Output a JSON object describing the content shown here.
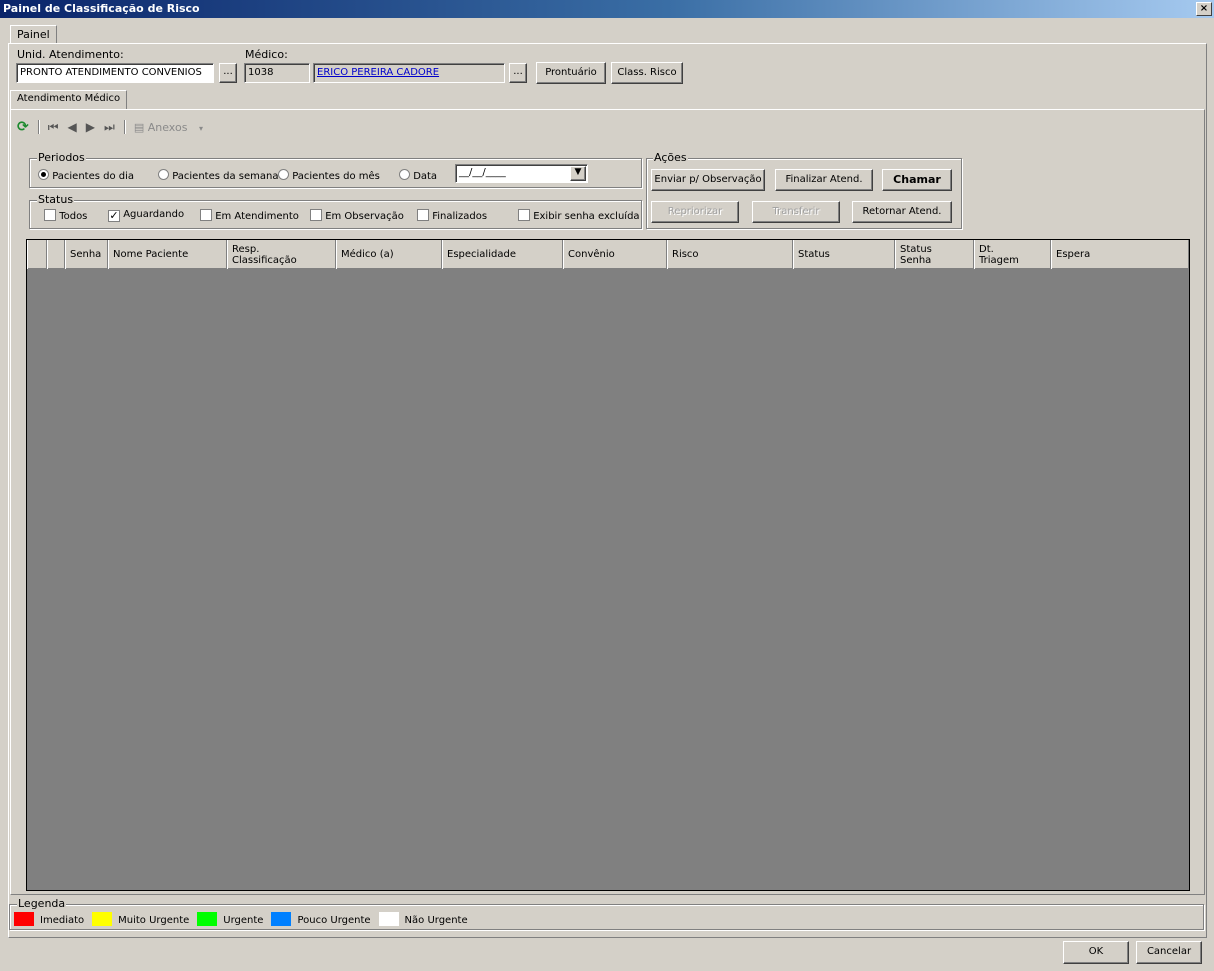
{
  "window": {
    "title": "Painel de Classificação de Risco",
    "close_label": "×"
  },
  "tabs": {
    "outer": "Painel",
    "inner": "Atendimento Médico"
  },
  "header": {
    "unid_label": "Unid. Atendimento:",
    "unid_value": "PRONTO ATENDIMENTO CONVENIOS",
    "medico_label": "Médico:",
    "medico_code": "1038",
    "medico_name": "ERICO PEREIRA CADORE",
    "dots_label": "...",
    "prontuario_label": "Prontuário",
    "class_risco_label": "Class. Risco"
  },
  "toolbar": {
    "anexos_label": "Anexos"
  },
  "periodos": {
    "title": "Periodos",
    "options": [
      "Pacientes do dia",
      "Pacientes da semana",
      "Pacientes do mês",
      "Data"
    ],
    "selected": 0,
    "date_value": "__/__/____"
  },
  "status": {
    "title": "Status",
    "options": [
      {
        "label": "Todos",
        "checked": false
      },
      {
        "label": "Aguardando",
        "checked": true
      },
      {
        "label": "Em Atendimento",
        "checked": false
      },
      {
        "label": "Em Observação",
        "checked": false
      },
      {
        "label": "Finalizados",
        "checked": false
      }
    ],
    "exibir_label": "Exibir senha excluída",
    "exibir_checked": false
  },
  "acoes": {
    "title": "Ações",
    "enviar": "Enviar p/ Observação",
    "finalizar": "Finalizar Atend.",
    "chamar": "Chamar",
    "repriorizar": "Repriorizar",
    "transferir": "Transferir",
    "retornar": "Retornar Atend."
  },
  "grid": {
    "columns": [
      {
        "l1": "",
        "l2": ""
      },
      {
        "l1": "",
        "l2": ""
      },
      {
        "l1": "Senha",
        "l2": ""
      },
      {
        "l1": "Nome Paciente",
        "l2": ""
      },
      {
        "l1": "Resp.",
        "l2": "Classificação"
      },
      {
        "l1": "Médico (a)",
        "l2": ""
      },
      {
        "l1": "Especialidade",
        "l2": ""
      },
      {
        "l1": "Convênio",
        "l2": ""
      },
      {
        "l1": "Risco",
        "l2": ""
      },
      {
        "l1": "Status",
        "l2": ""
      },
      {
        "l1": "Status",
        "l2": "Senha"
      },
      {
        "l1": "Dt.",
        "l2": "Triagem"
      },
      {
        "l1": "Espera",
        "l2": ""
      }
    ]
  },
  "legenda": {
    "title": "Legenda",
    "items": [
      {
        "label": "Imediato",
        "color": "#ff0000"
      },
      {
        "label": "Muito Urgente",
        "color": "#ffff00"
      },
      {
        "label": "Urgente",
        "color": "#00ff00"
      },
      {
        "label": "Pouco Urgente",
        "color": "#0080ff"
      },
      {
        "label": "Não Urgente",
        "color": "#ffffff"
      }
    ]
  },
  "footer": {
    "ok": "OK",
    "cancelar": "Cancelar"
  }
}
